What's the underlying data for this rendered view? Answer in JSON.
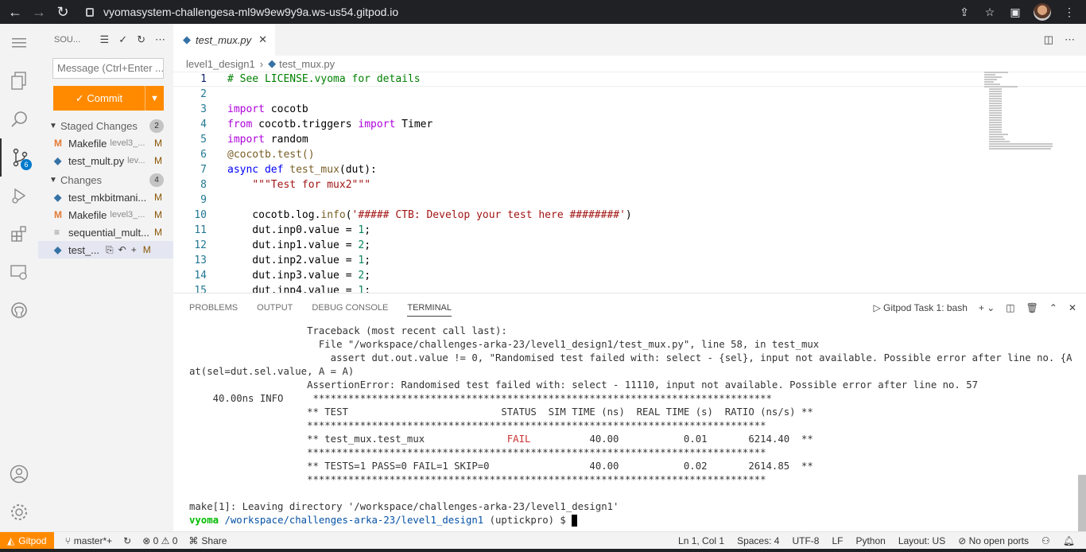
{
  "browser": {
    "url": "vyomasystem-challengesa-ml9w9ew9y9a.ws-us54.gitpod.io",
    "back_icon": "arrow-left-icon",
    "forward_icon": "arrow-right-icon",
    "reload_icon": "reload-icon"
  },
  "activity": {
    "scm_badge": "6"
  },
  "sidebar": {
    "title": "SOU...",
    "message_placeholder": "Message (Ctrl+Enter ...",
    "commit_label": "✓ Commit",
    "staged": {
      "label": "Staged Changes",
      "count": "2",
      "files": [
        {
          "name": "Makefile",
          "dir": "level3_...",
          "status": "M",
          "icon": "M"
        },
        {
          "name": "test_mult.py",
          "dir": "lev...",
          "status": "M",
          "icon": "py"
        }
      ]
    },
    "changes": {
      "label": "Changes",
      "count": "4",
      "files": [
        {
          "name": "test_mkbitmani...",
          "dir": "",
          "status": "M",
          "icon": "py"
        },
        {
          "name": "Makefile",
          "dir": "level3_...",
          "status": "M",
          "icon": "M"
        },
        {
          "name": "sequential_mult...",
          "dir": "",
          "status": "M",
          "icon": "txt"
        },
        {
          "name": "test_...",
          "dir": "",
          "status": "M",
          "icon": "py"
        }
      ]
    }
  },
  "editor": {
    "tab_label": "test_mux.py",
    "breadcrumb_folder": "level1_design1",
    "breadcrumb_file": "test_mux.py",
    "line_numbers": [
      "1",
      "2",
      "3",
      "4",
      "5",
      "6",
      "7",
      "8",
      "9",
      "10",
      "11",
      "12",
      "13",
      "14",
      "15"
    ]
  },
  "panel": {
    "tabs": [
      "PROBLEMS",
      "OUTPUT",
      "DEBUG CONSOLE",
      "TERMINAL"
    ],
    "terminal_name": "Gitpod Task 1: bash",
    "lines": [
      "                    Traceback (most recent call last):",
      "                      File \"/workspace/challenges-arka-23/level1_design1/test_mux.py\", line 58, in test_mux",
      "                        assert dut.out.value != 0, \"Randomised test failed with: select - {sel}, input not available. Possible error after line no. {A}\".form",
      "at(sel=dut.sel.value, A = A)",
      "                    AssertionError: Randomised test failed with: select - 11110, input not available. Possible error after line no. 57",
      "    40.00ns INFO     ******************************************************************************",
      "                    ** TEST                          STATUS  SIM TIME (ns)  REAL TIME (s)  RATIO (ns/s) **",
      "                    ******************************************************************************",
      "                    ** test_mux.test_mux              FAIL          40.00           0.01       6214.40  **",
      "                    ******************************************************************************",
      "                    ** TESTS=1 PASS=0 FAIL=1 SKIP=0                 40.00           0.02       2614.85  **",
      "                    ******************************************************************************",
      "",
      "make[1]: Leaving directory '/workspace/challenges-arka-23/level1_design1'"
    ],
    "prompt_user": "vyoma",
    "prompt_path": "/workspace/challenges-arka-23/level1_design1",
    "prompt_branch": "(uptickpro) $"
  },
  "status": {
    "gitpod": "Gitpod",
    "branch": "master*+",
    "problems": "⊗ 0 ⚠ 0",
    "share": "Share",
    "position": "Ln 1, Col 1",
    "spaces": "Spaces: 4",
    "encoding": "UTF-8",
    "eol": "LF",
    "language": "Python",
    "layout": "Layout: US",
    "ports": "No open ports"
  }
}
